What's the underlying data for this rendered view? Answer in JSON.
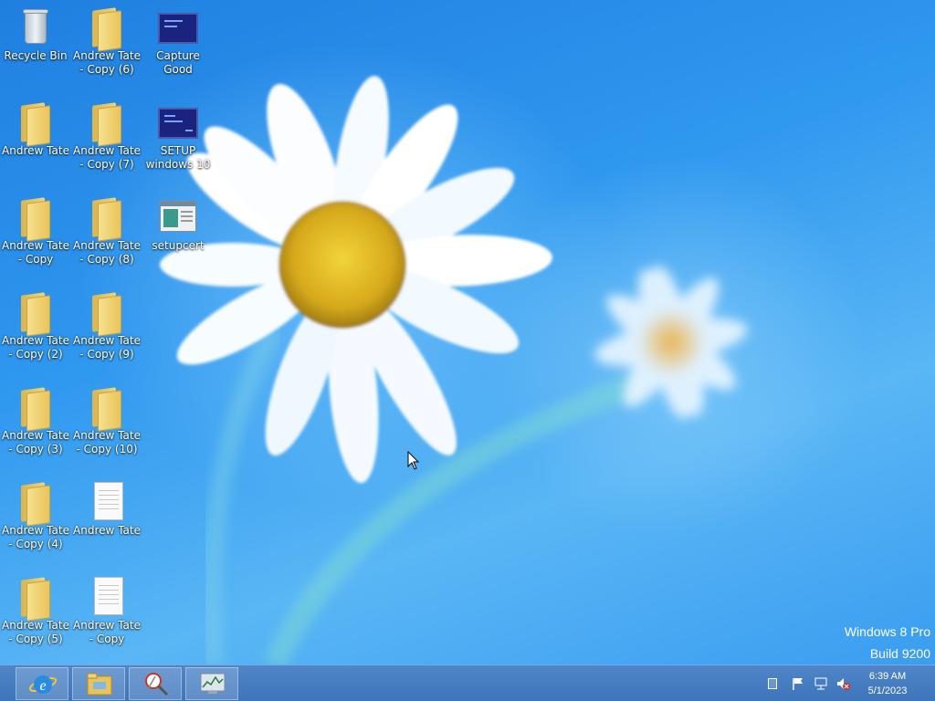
{
  "desktop": {
    "icons": [
      {
        "label": "Recycle Bin",
        "icon": "recycle-bin-icon"
      },
      {
        "label": "Andrew Tate - Copy (6)",
        "icon": "folder-icon"
      },
      {
        "label": "Capture Good",
        "icon": "screen-app-icon"
      },
      {
        "label": "Andrew Tate",
        "icon": "folder-icon"
      },
      {
        "label": "Andrew Tate - Copy (7)",
        "icon": "folder-icon"
      },
      {
        "label": "SETUP windows 10",
        "icon": "screen-app-icon"
      },
      {
        "label": "Andrew Tate - Copy",
        "icon": "folder-icon"
      },
      {
        "label": "Andrew Tate - Copy (8)",
        "icon": "folder-icon"
      },
      {
        "label": "setupcert",
        "icon": "setup-window-icon"
      },
      {
        "label": "Andrew Tate - Copy (2)",
        "icon": "folder-icon"
      },
      {
        "label": "Andrew Tate - Copy (9)",
        "icon": "folder-icon"
      },
      {
        "label": "Andrew Tate - Copy (3)",
        "icon": "folder-icon"
      },
      {
        "label": "Andrew Tate - Copy (10)",
        "icon": "folder-icon"
      },
      {
        "label": "Andrew Tate - Copy (4)",
        "icon": "folder-icon"
      },
      {
        "label": "Andrew Tate",
        "icon": "text-document-icon"
      },
      {
        "label": "Andrew Tate - Copy (5)",
        "icon": "folder-icon"
      },
      {
        "label": "Andrew Tate - Copy",
        "icon": "text-document-icon"
      }
    ]
  },
  "watermark": {
    "edition": "Windows 8 Pro",
    "build": "Build 9200"
  },
  "taskbar": {
    "pinned": [
      {
        "name": "internet-explorer-icon"
      },
      {
        "name": "file-explorer-icon"
      },
      {
        "name": "magnifier-tool-icon"
      },
      {
        "name": "performance-monitor-icon"
      }
    ],
    "tray": {
      "icons": [
        "show-desktop-icon",
        "action-center-flag-icon",
        "network-icon",
        "volume-muted-icon"
      ],
      "time": "6:39 AM",
      "date": "5/1/2023"
    }
  },
  "colors": {
    "desktop_blue": "#2f98ef",
    "taskbar": "#4480c4",
    "folder_yellow": "#f0d37c"
  }
}
